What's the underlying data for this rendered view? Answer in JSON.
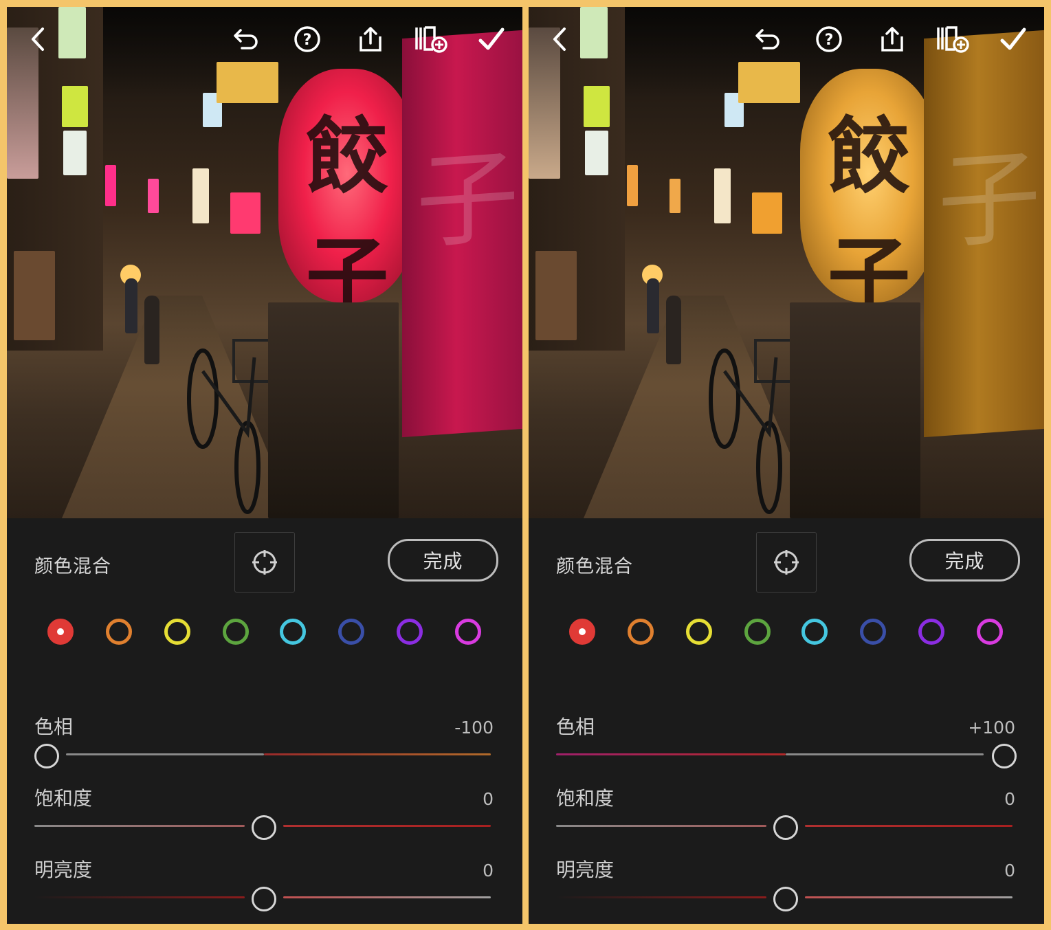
{
  "panels": [
    {
      "id": "left",
      "title": "颜色混合",
      "done_label": "完成",
      "lantern_char": "餃子",
      "banner_char": "子",
      "sliders": [
        {
          "label": "色相",
          "value": "-100"
        },
        {
          "label": "饱和度",
          "value": "0"
        },
        {
          "label": "明亮度",
          "value": "0"
        }
      ],
      "lantern_color": "#f0204a",
      "banner_color": "#c8184e"
    },
    {
      "id": "right",
      "title": "颜色混合",
      "done_label": "完成",
      "lantern_char": "餃子",
      "banner_char": "子",
      "sliders": [
        {
          "label": "色相",
          "value": "+100"
        },
        {
          "label": "饱和度",
          "value": "0"
        },
        {
          "label": "明亮度",
          "value": "0"
        }
      ],
      "lantern_color": "#e8a437",
      "banner_color": "#b07a20"
    }
  ],
  "toolbar_icons": [
    "back-icon",
    "undo-icon",
    "help-icon",
    "share-icon",
    "add-preset-icon",
    "confirm-icon"
  ],
  "swatch_colors": [
    "#e03a36",
    "#e0802f",
    "#e6de35",
    "#5da53f",
    "#45c7e0",
    "#3a4fa8",
    "#8b2de2",
    "#d93be0"
  ],
  "selected_swatch": 0,
  "accent": {
    "background": "#1b1b1b",
    "frame": "#f4c56a"
  }
}
